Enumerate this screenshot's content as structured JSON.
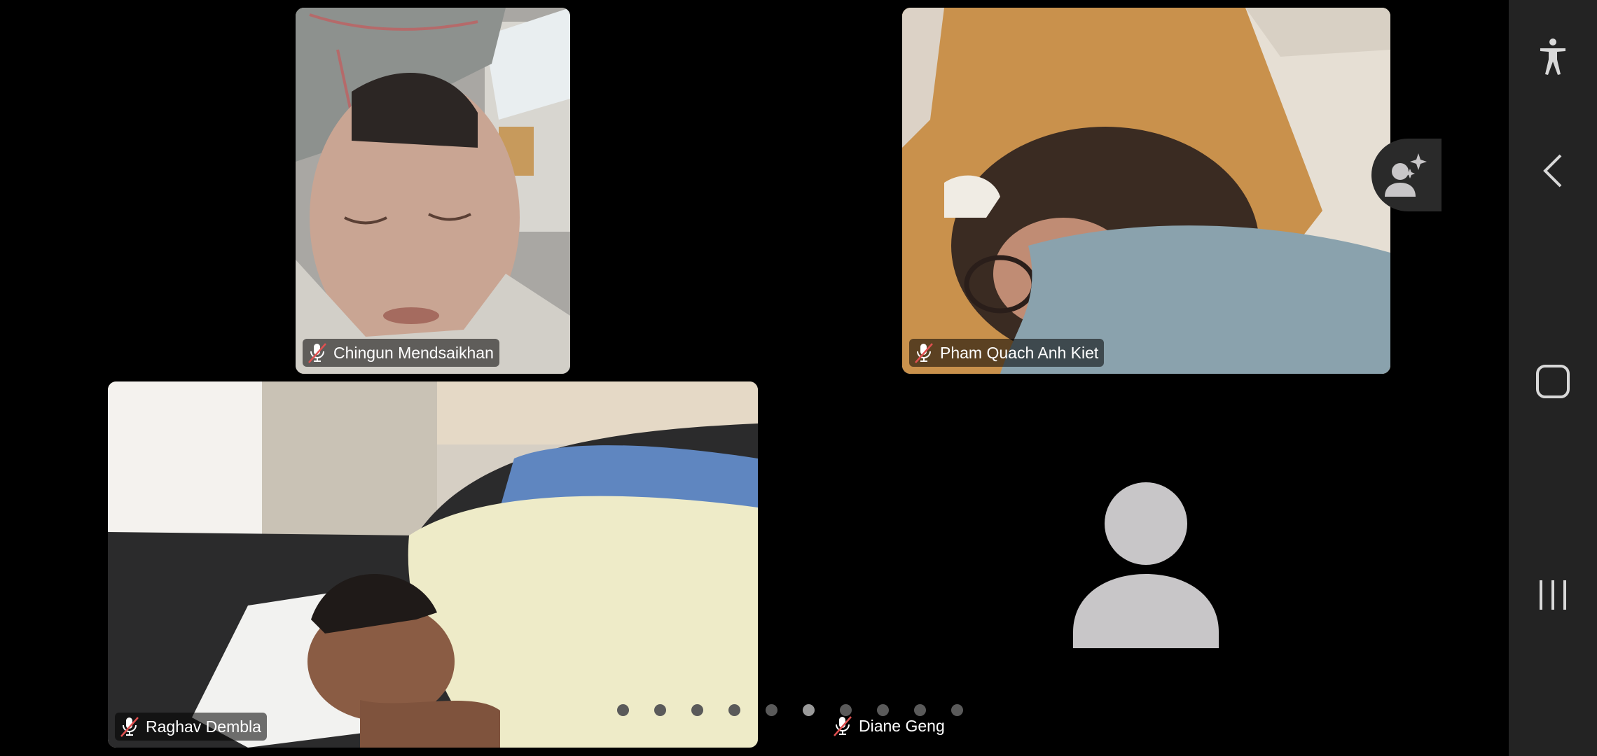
{
  "meeting": {
    "participants": [
      {
        "name": "Chingun Mendsaikhan",
        "muted": true,
        "video": true
      },
      {
        "name": "Pham Quach Anh Kiet",
        "muted": true,
        "video": true
      },
      {
        "name": "Raghav Dembla",
        "muted": true,
        "video": true
      },
      {
        "name": "Diane Geng",
        "muted": true,
        "video": false
      }
    ],
    "pagination": {
      "total_pages": 10,
      "current_page": 6
    }
  },
  "icons": {
    "mic_muted": "mic-off-icon",
    "avatar": "person-icon",
    "add_people": "add-people-sparkle-icon",
    "accessibility": "accessibility-icon",
    "back": "chevron-left-icon",
    "home": "square-home-icon",
    "recents": "recents-icon"
  },
  "colors": {
    "background": "#000000",
    "navbar": "#232323",
    "mute_slash": "#e05050",
    "avatar_gray": "#c8c6c8"
  }
}
